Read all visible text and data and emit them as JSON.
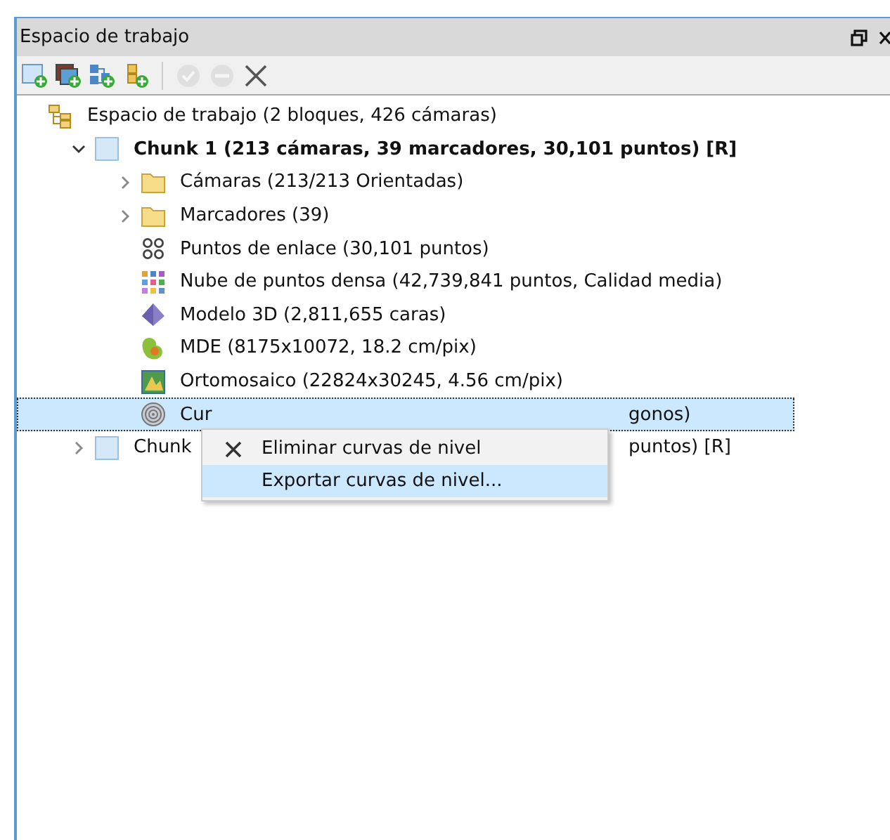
{
  "panel": {
    "title": "Espacio de trabajo"
  },
  "toolbar": [
    {
      "kind": "add-chunk",
      "disabled": false
    },
    {
      "kind": "add-photos",
      "disabled": false
    },
    {
      "kind": "add-folder",
      "disabled": false
    },
    {
      "kind": "add-marker",
      "disabled": false
    },
    {
      "kind": "enable",
      "disabled": true
    },
    {
      "kind": "disable",
      "disabled": true
    },
    {
      "kind": "remove",
      "disabled": false
    }
  ],
  "tree": {
    "label": "Espacio de trabajo (2 bloques, 426 cámaras)",
    "kind": "workspace",
    "children": [
      {
        "label": "Chunk 1 (213 cámaras, 39 marcadores, 30,101 puntos) [R]",
        "kind": "chunk",
        "active": true,
        "expanded": true,
        "selected": false,
        "children": [
          {
            "label": "Cámaras (213/213 Orientadas)",
            "kind": "folder",
            "expanded": false,
            "selected": false
          },
          {
            "label": "Marcadores (39)",
            "kind": "folder",
            "expanded": false,
            "selected": false
          },
          {
            "label": "Puntos de enlace (30,101 puntos)",
            "kind": "tie-points",
            "selected": false
          },
          {
            "label": "Nube de puntos densa (42,739,841 puntos, Calidad media)",
            "kind": "dense-cloud",
            "selected": false
          },
          {
            "label": "Modelo 3D (2,811,655 caras)",
            "kind": "model",
            "selected": false
          },
          {
            "label": "MDE (8175x10072, 18.2 cm/pix)",
            "kind": "dem",
            "selected": false
          },
          {
            "label": "Ortomosaico (22824x30245, 4.56 cm/pix)",
            "kind": "ortho",
            "selected": false
          },
          {
            "label_parts": [
              "Cur",
              "gonos)"
            ],
            "kind": "contours",
            "selected": true
          }
        ]
      },
      {
        "label_parts": [
          "Chunk",
          "puntos) [R]"
        ],
        "kind": "chunk",
        "active": false,
        "expanded": false,
        "selected": false
      }
    ]
  },
  "context_menu": [
    {
      "label": "Eliminar curvas de nivel",
      "kind": "delete",
      "selected": false
    },
    {
      "label": "Exportar curvas de nivel...",
      "selected": true
    }
  ]
}
